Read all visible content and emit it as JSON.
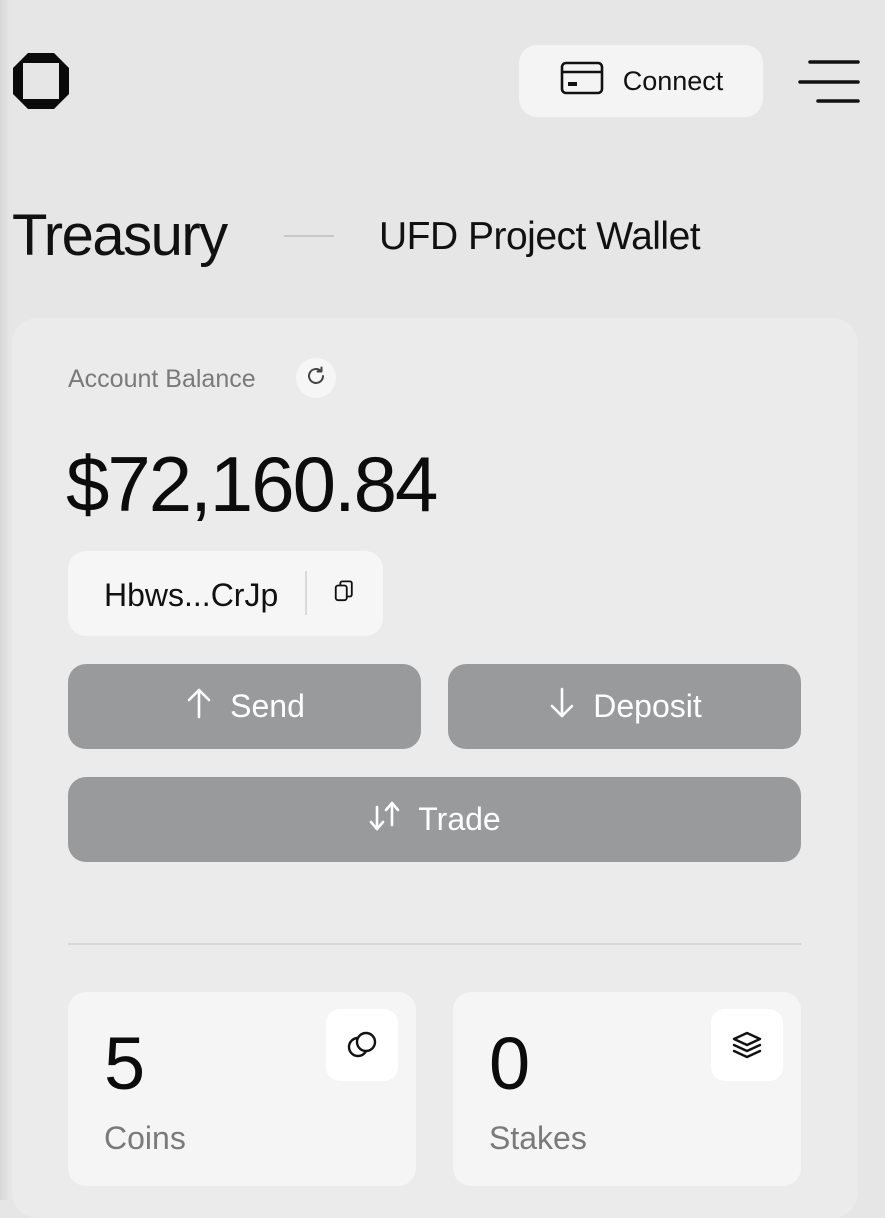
{
  "header": {
    "logo_icon": "octagon-logo-icon",
    "connect_label": "Connect",
    "connect_icon": "card-icon",
    "menu_icon": "hamburger-menu-icon"
  },
  "page": {
    "title": "Treasury",
    "wallet_name": "UFD Project Wallet"
  },
  "balance": {
    "label": "Account Balance",
    "refresh_icon": "refresh-icon",
    "value": "$72,160.84",
    "address": "Hbws...CrJp",
    "copy_icon": "copy-icon"
  },
  "actions": {
    "send_label": "Send",
    "deposit_label": "Deposit",
    "trade_label": "Trade"
  },
  "stats": [
    {
      "value": "5",
      "label": "Coins",
      "icon": "coins-icon"
    },
    {
      "value": "0",
      "label": "Stakes",
      "icon": "layers-icon"
    }
  ],
  "colors": {
    "background": "#e6e6e6",
    "card": "#ebebeb",
    "button": "#999a9c",
    "muted_text": "#7a7a7a"
  }
}
